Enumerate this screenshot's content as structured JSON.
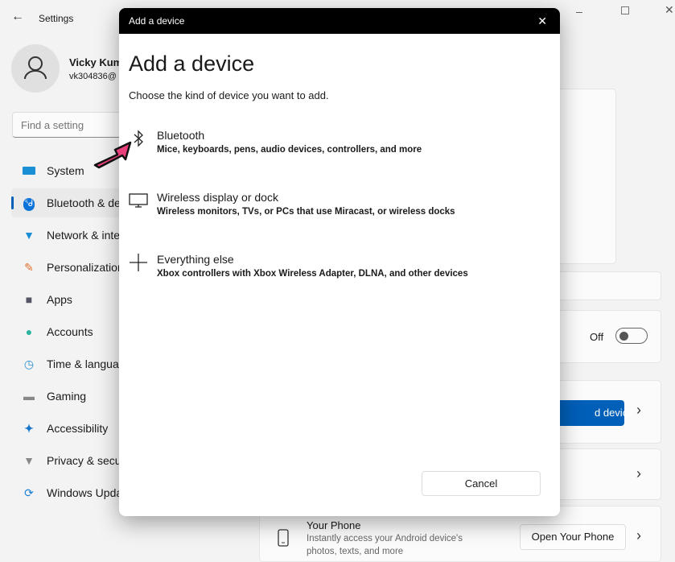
{
  "window": {
    "title": "Settings"
  },
  "user": {
    "name": "Vicky Kum",
    "email": "vk304836@"
  },
  "search": {
    "placeholder": "Find a setting"
  },
  "sidebar": {
    "items": [
      {
        "label": "System",
        "icon": "system-icon"
      },
      {
        "label": "Bluetooth & de",
        "icon": "bluetooth-icon",
        "selected": true
      },
      {
        "label": "Network & inte",
        "icon": "wifi-icon"
      },
      {
        "label": "Personalization",
        "icon": "brush-icon"
      },
      {
        "label": "Apps",
        "icon": "apps-icon"
      },
      {
        "label": "Accounts",
        "icon": "person-icon"
      },
      {
        "label": "Time & langua",
        "icon": "clock-globe-icon"
      },
      {
        "label": "Gaming",
        "icon": "gamepad-icon"
      },
      {
        "label": "Accessibility",
        "icon": "accessibility-icon"
      },
      {
        "label": "Privacy & secu",
        "icon": "shield-icon"
      },
      {
        "label": "Windows Upda",
        "icon": "update-icon"
      }
    ]
  },
  "main": {
    "toggle_label": "Off",
    "toggle_on": false,
    "add_device_label": "d device",
    "your_phone": {
      "title": "Your Phone",
      "desc1": "Instantly access your Android device's",
      "desc2": "photos, texts, and more",
      "button": "Open Your Phone"
    }
  },
  "dialog": {
    "titlebar": "Add a device",
    "heading": "Add a device",
    "subtitle": "Choose the kind of device you want to add.",
    "options": [
      {
        "title": "Bluetooth",
        "desc": "Mice, keyboards, pens, audio devices, controllers, and more",
        "icon": "bluetooth-icon"
      },
      {
        "title": "Wireless display or dock",
        "desc": "Wireless monitors, TVs, or PCs that use Miracast, or wireless docks",
        "icon": "monitor-icon"
      },
      {
        "title": "Everything else",
        "desc": "Xbox controllers with Xbox Wireless Adapter, DLNA, and other devices",
        "icon": "plus-icon"
      }
    ],
    "cancel": "Cancel"
  },
  "colors": {
    "accent": "#005fb8",
    "arrow": "#e8407a"
  }
}
